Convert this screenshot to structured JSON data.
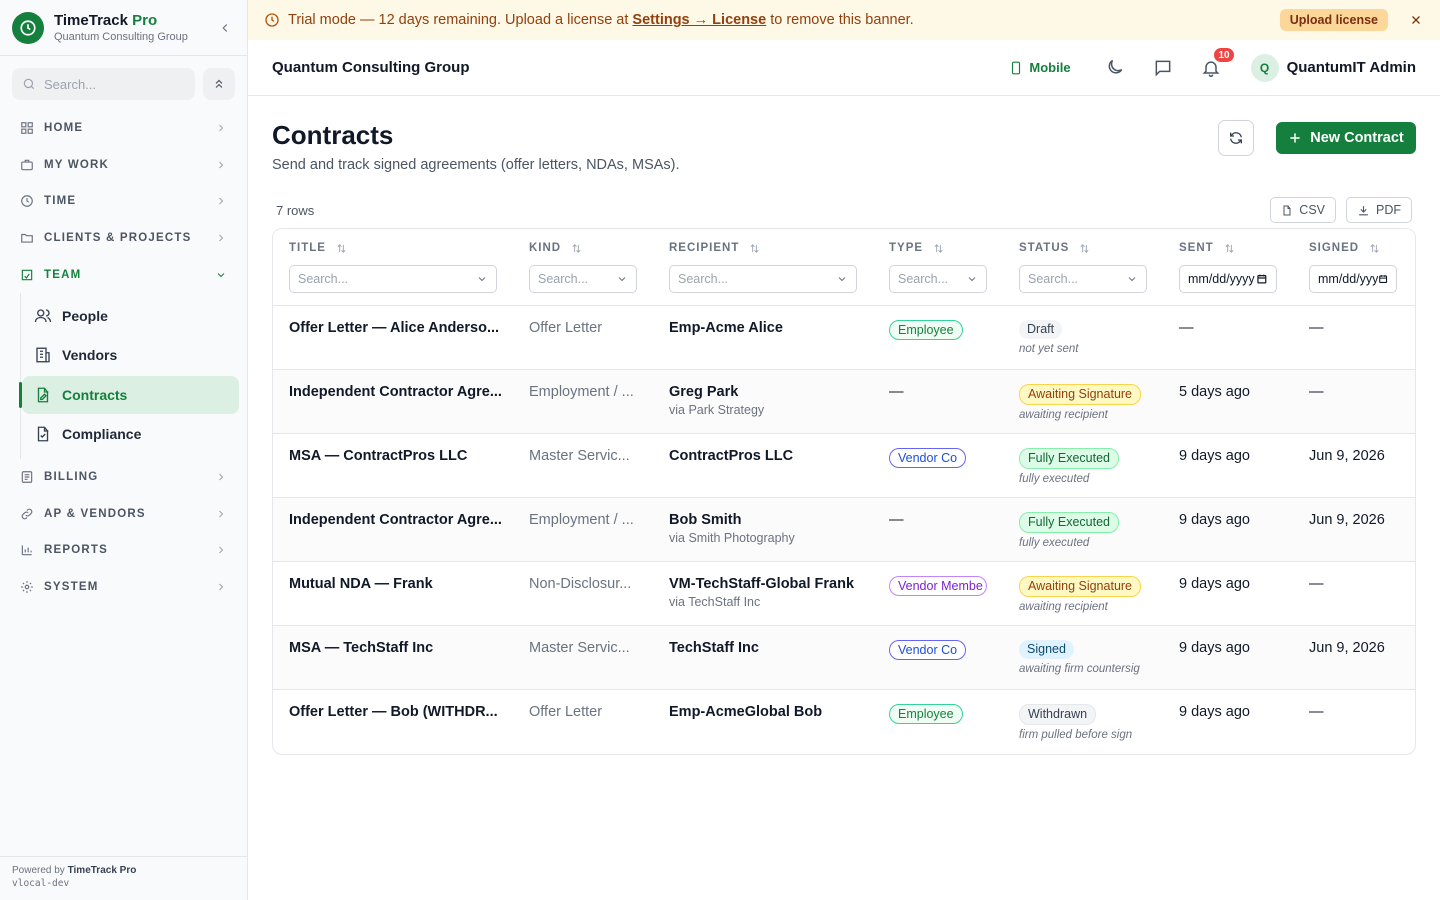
{
  "brand": {
    "name": "TimeTrack",
    "name_suffix": "Pro",
    "org": "Quantum Consulting Group"
  },
  "sidebar": {
    "search_placeholder": "Search...",
    "sections": [
      {
        "id": "home",
        "label": "HOME",
        "icon": "grid-icon"
      },
      {
        "id": "my-work",
        "label": "MY WORK",
        "icon": "briefcase-icon"
      },
      {
        "id": "time",
        "label": "TIME",
        "icon": "clock-icon"
      },
      {
        "id": "clients-projects",
        "label": "CLIENTS & PROJECTS",
        "icon": "folder-icon"
      },
      {
        "id": "team",
        "label": "TEAM",
        "icon": "users-icon"
      }
    ],
    "team_items": [
      {
        "label": "People"
      },
      {
        "label": "Vendors"
      },
      {
        "label": "Contracts"
      },
      {
        "label": "Compliance"
      }
    ],
    "sections_after": [
      {
        "label": "BILLING"
      },
      {
        "label": "AP & VENDORS"
      },
      {
        "label": "REPORTS"
      },
      {
        "label": "SYSTEM"
      }
    ],
    "footer": {
      "powered_prefix": "Powered by",
      "powered_brand": "TimeTrack Pro",
      "version": "vlocal-dev"
    }
  },
  "banner": {
    "text_before": "Trial mode — 12 days remaining. Upload a license at",
    "link": "Settings → License",
    "text_after": "to remove this banner.",
    "button": "Upload license"
  },
  "topbar": {
    "org": "Quantum Consulting Group",
    "mobile": "Mobile",
    "notifications": "10",
    "avatar_initial": "Q",
    "user": "QuantumIT Admin"
  },
  "page": {
    "title": "Contracts",
    "subtitle": "Send and track signed agreements (offer letters, NDAs, MSAs).",
    "new_button": "New Contract",
    "row_count": "7 rows",
    "csv": "CSV",
    "pdf": "PDF"
  },
  "table": {
    "columns": [
      "TITLE",
      "KIND",
      "RECIPIENT",
      "TYPE",
      "STATUS",
      "SENT",
      "SIGNED"
    ],
    "filter_placeholder": "Search...",
    "date_placeholder": "mm/dd/yyyy",
    "rows": [
      {
        "title": "Offer Letter — Alice Anderso...",
        "kind": "Offer Letter",
        "recipient": "Emp-Acme Alice",
        "via": "",
        "type": "Employee",
        "status": "Draft",
        "status_note": "not yet sent",
        "sent": "—",
        "signed": "—"
      },
      {
        "title": "Independent Contractor Agre...",
        "kind": "Employment / ...",
        "recipient": "Greg Park",
        "via": "via Park Strategy",
        "type": "—",
        "status": "Awaiting Signature",
        "status_note": "awaiting recipient",
        "sent": "5 days ago",
        "signed": "—"
      },
      {
        "title": "MSA — ContractPros LLC",
        "kind": "Master Servic...",
        "recipient": "ContractPros LLC",
        "via": "",
        "type": "Vendor Co",
        "status": "Fully Executed",
        "status_note": "fully executed",
        "sent": "9 days ago",
        "signed": "Jun 9, 2026"
      },
      {
        "title": "Independent Contractor Agre...",
        "kind": "Employment / ...",
        "recipient": "Bob Smith",
        "via": "via Smith Photography",
        "type": "—",
        "status": "Fully Executed",
        "status_note": "fully executed",
        "sent": "9 days ago",
        "signed": "Jun 9, 2026"
      },
      {
        "title": "Mutual NDA — Frank",
        "kind": "Non-Disclosur...",
        "recipient": "VM-TechStaff-Global Frank",
        "via": "via TechStaff Inc",
        "type": "Vendor Membe",
        "status": "Awaiting Signature",
        "status_note": "awaiting recipient",
        "sent": "9 days ago",
        "signed": "—"
      },
      {
        "title": "MSA — TechStaff Inc",
        "kind": "Master Servic...",
        "recipient": "TechStaff Inc",
        "via": "",
        "type": "Vendor Co",
        "status": "Signed",
        "status_note": "awaiting firm countersig",
        "sent": "9 days ago",
        "signed": "Jun 9, 2026"
      },
      {
        "title": "Offer Letter — Bob (WITHDR...",
        "kind": "Offer Letter",
        "recipient": "Emp-AcmeGlobal Bob",
        "via": "",
        "type": "Employee",
        "status": "Withdrawn",
        "status_note": "firm pulled before sign",
        "sent": "9 days ago",
        "signed": "—"
      }
    ]
  },
  "colors": {
    "accent": "#15803d",
    "banner_bg": "#fef9e6",
    "banner_text": "#92400e"
  }
}
